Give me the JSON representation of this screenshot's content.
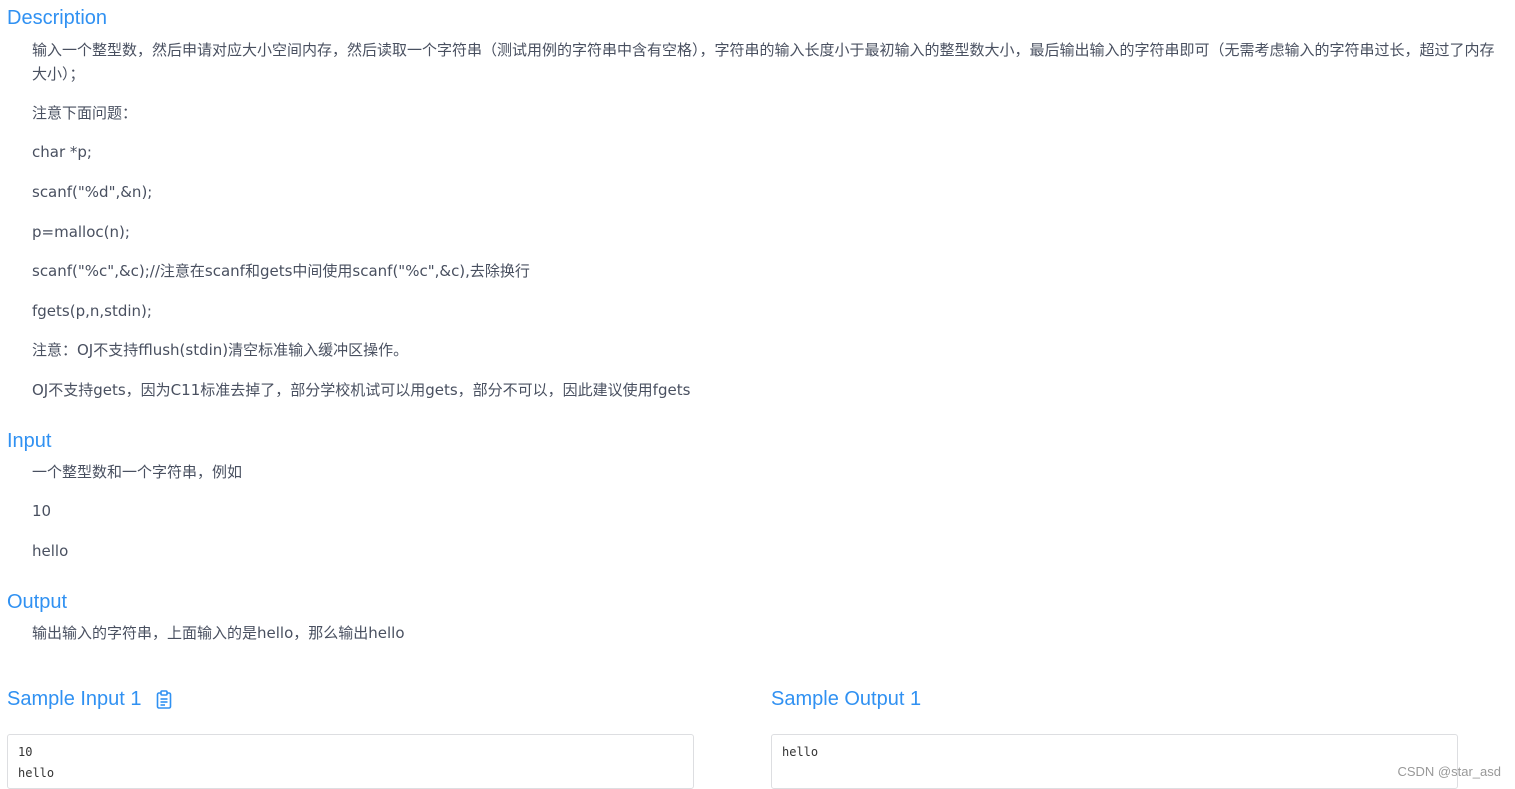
{
  "description": {
    "title": "Description",
    "paragraphs": [
      "输入一个整型数，然后申请对应大小空间内存，然后读取一个字符串（测试用例的字符串中含有空格），字符串的输入长度小于最初输入的整型数大小，最后输出输入的字符串即可（无需考虑输入的字符串过长，超过了内存大小）；",
      "注意下面问题：",
      "char *p;",
      "scanf(\"%d\",&n);",
      "p=malloc(n);",
      "scanf(\"%c\",&c);//注意在scanf和gets中间使用scanf(\"%c\",&c),去除换行",
      "fgets(p,n,stdin);",
      "注意：OJ不支持fflush(stdin)清空标准输入缓冲区操作。",
      "OJ不支持gets，因为C11标准去掉了，部分学校机试可以用gets，部分不可以，因此建议使用fgets"
    ]
  },
  "input": {
    "title": "Input",
    "paragraphs": [
      "一个整型数和一个字符串，例如",
      "10",
      "hello"
    ]
  },
  "output": {
    "title": "Output",
    "paragraphs": [
      "输出输入的字符串，上面输入的是hello，那么输出hello"
    ]
  },
  "sample_input": {
    "title": "Sample Input 1",
    "content": "10\nhello",
    "icon": "clipboard-icon"
  },
  "sample_output": {
    "title": "Sample Output 1",
    "content": "hello"
  },
  "watermark": "CSDN @star_asd",
  "colors": {
    "heading": "#3091f2",
    "text": "#495060",
    "border": "#dddee1"
  }
}
